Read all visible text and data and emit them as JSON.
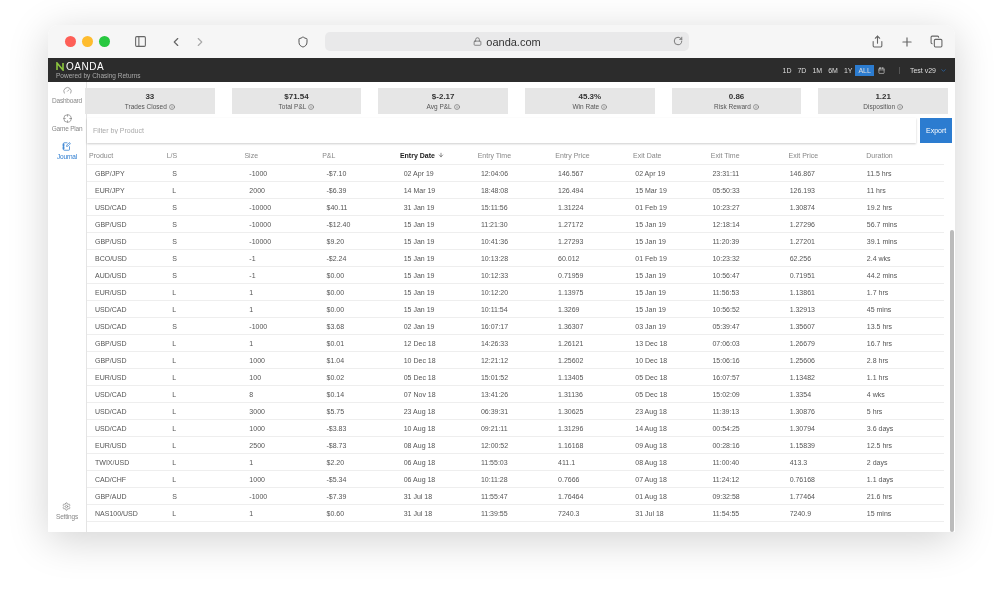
{
  "browser": {
    "url": "oanda.com"
  },
  "app_bar": {
    "logo": "OANDA",
    "tagline": "Powered by Chasing Returns",
    "ranges": [
      {
        "label": "1D",
        "selected": false
      },
      {
        "label": "7D",
        "selected": false
      },
      {
        "label": "1M",
        "selected": false
      },
      {
        "label": "6M",
        "selected": false
      },
      {
        "label": "1Y",
        "selected": false
      },
      {
        "label": "ALL",
        "selected": true
      }
    ],
    "account": "Test v29"
  },
  "sidebar": {
    "items": [
      {
        "label": "Dashboard",
        "kind": "gauge",
        "selected": false
      },
      {
        "label": "Game Plan",
        "kind": "target",
        "selected": false
      },
      {
        "label": "Journal",
        "kind": "journal",
        "selected": true
      }
    ],
    "settings": "Settings"
  },
  "stats": [
    {
      "value": "33",
      "label": "Trades Closed"
    },
    {
      "value": "$71.54",
      "label": "Total P&L"
    },
    {
      "value": "$-2.17",
      "label": "Avg P&L"
    },
    {
      "value": "45.3%",
      "label": "Win Rate"
    },
    {
      "value": "0.86",
      "label": "Risk Reward"
    },
    {
      "value": "1.21",
      "label": "Disposition"
    }
  ],
  "filter": {
    "placeholder": "Filter by Product"
  },
  "export_button": "Export",
  "table": {
    "columns": [
      {
        "label": "Product",
        "sorted": false
      },
      {
        "label": "L/S",
        "sorted": false
      },
      {
        "label": "Size",
        "sorted": false
      },
      {
        "label": "P&L",
        "sorted": false
      },
      {
        "label": "Entry Date",
        "sorted": true
      },
      {
        "label": "Entry Time",
        "sorted": false
      },
      {
        "label": "Entry Price",
        "sorted": false
      },
      {
        "label": "Exit Date",
        "sorted": false
      },
      {
        "label": "Exit Time",
        "sorted": false
      },
      {
        "label": "Exit Price",
        "sorted": false
      },
      {
        "label": "Duration",
        "sorted": false
      }
    ],
    "rows": [
      [
        "GBP/JPY",
        "S",
        "-1000",
        "-$7.10",
        "02 Apr 19",
        "12:04:06",
        "146.567",
        "02 Apr 19",
        "23:31:11",
        "146.867",
        "11.5 hrs"
      ],
      [
        "EUR/JPY",
        "L",
        "2000",
        "-$6.39",
        "14 Mar 19",
        "18:48:08",
        "126.494",
        "15 Mar 19",
        "05:50:33",
        "126.193",
        "11 hrs"
      ],
      [
        "USD/CAD",
        "S",
        "-10000",
        "$40.11",
        "31 Jan 19",
        "15:11:56",
        "1.31224",
        "01 Feb 19",
        "10:23:27",
        "1.30874",
        "19.2 hrs"
      ],
      [
        "GBP/USD",
        "S",
        "-10000",
        "-$12.40",
        "15 Jan 19",
        "11:21:30",
        "1.27172",
        "15 Jan 19",
        "12:18:14",
        "1.27296",
        "56.7 mins"
      ],
      [
        "GBP/USD",
        "S",
        "-10000",
        "$9.20",
        "15 Jan 19",
        "10:41:36",
        "1.27293",
        "15 Jan 19",
        "11:20:39",
        "1.27201",
        "39.1 mins"
      ],
      [
        "BCO/USD",
        "S",
        "-1",
        "-$2.24",
        "15 Jan 19",
        "10:13:28",
        "60.012",
        "01 Feb 19",
        "10:23:32",
        "62.256",
        "2.4 wks"
      ],
      [
        "AUD/USD",
        "S",
        "-1",
        "$0.00",
        "15 Jan 19",
        "10:12:33",
        "0.71959",
        "15 Jan 19",
        "10:56:47",
        "0.71951",
        "44.2 mins"
      ],
      [
        "EUR/USD",
        "L",
        "1",
        "$0.00",
        "15 Jan 19",
        "10:12:20",
        "1.13975",
        "15 Jan 19",
        "11:56:53",
        "1.13861",
        "1.7 hrs"
      ],
      [
        "USD/CAD",
        "L",
        "1",
        "$0.00",
        "15 Jan 19",
        "10:11:54",
        "1.3269",
        "15 Jan 19",
        "10:56:52",
        "1.32913",
        "45 mins"
      ],
      [
        "USD/CAD",
        "S",
        "-1000",
        "$3.68",
        "02 Jan 19",
        "16:07:17",
        "1.36307",
        "03 Jan 19",
        "05:39:47",
        "1.35607",
        "13.5 hrs"
      ],
      [
        "GBP/USD",
        "L",
        "1",
        "$0.01",
        "12 Dec 18",
        "14:26:33",
        "1.26121",
        "13 Dec 18",
        "07:06:03",
        "1.26679",
        "16.7 hrs"
      ],
      [
        "GBP/USD",
        "L",
        "1000",
        "$1.04",
        "10 Dec 18",
        "12:21:12",
        "1.25602",
        "10 Dec 18",
        "15:06:16",
        "1.25606",
        "2.8 hrs"
      ],
      [
        "EUR/USD",
        "L",
        "100",
        "$0.02",
        "05 Dec 18",
        "15:01:52",
        "1.13405",
        "05 Dec 18",
        "16:07:57",
        "1.13482",
        "1.1 hrs"
      ],
      [
        "USD/CAD",
        "L",
        "8",
        "$0.14",
        "07 Nov 18",
        "13:41:26",
        "1.31136",
        "05 Dec 18",
        "15:02:09",
        "1.3354",
        "4 wks"
      ],
      [
        "USD/CAD",
        "L",
        "3000",
        "$5.75",
        "23 Aug 18",
        "06:39:31",
        "1.30625",
        "23 Aug 18",
        "11:39:13",
        "1.30876",
        "5 hrs"
      ],
      [
        "USD/CAD",
        "L",
        "1000",
        "-$3.83",
        "10 Aug 18",
        "09:21:11",
        "1.31296",
        "14 Aug 18",
        "00:54:25",
        "1.30794",
        "3.6 days"
      ],
      [
        "EUR/USD",
        "L",
        "2500",
        "-$8.73",
        "08 Aug 18",
        "12:00:52",
        "1.16168",
        "09 Aug 18",
        "00:28:16",
        "1.15839",
        "12.5 hrs"
      ],
      [
        "TWIX/USD",
        "L",
        "1",
        "$2.20",
        "06 Aug 18",
        "11:55:03",
        "411.1",
        "08 Aug 18",
        "11:00:40",
        "413.3",
        "2 days"
      ],
      [
        "CAD/CHF",
        "L",
        "1000",
        "-$5.34",
        "06 Aug 18",
        "10:11:28",
        "0.7666",
        "07 Aug 18",
        "11:24:12",
        "0.76168",
        "1.1 days"
      ],
      [
        "GBP/AUD",
        "S",
        "-1000",
        "-$7.39",
        "31 Jul 18",
        "11:55:47",
        "1.76464",
        "01 Aug 18",
        "09:32:58",
        "1.77464",
        "21.6 hrs"
      ],
      [
        "NAS100/USD",
        "L",
        "1",
        "$0.60",
        "31 Jul 18",
        "11:39:55",
        "7240.3",
        "31 Jul 18",
        "11:54:55",
        "7240.9",
        "15 mins"
      ]
    ]
  }
}
